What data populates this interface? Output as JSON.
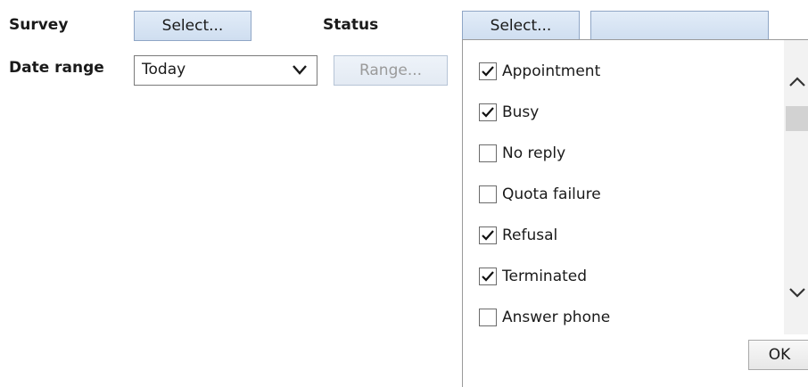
{
  "filters": {
    "survey_label": "Survey",
    "survey_button": "Select...",
    "status_label": "Status",
    "status_button": "Select...",
    "date_range_label": "Date range",
    "date_range_value": "Today",
    "range_button": "Range..."
  },
  "status_dropdown": {
    "options": [
      {
        "label": "Appointment",
        "checked": true
      },
      {
        "label": "Busy",
        "checked": true
      },
      {
        "label": "No reply",
        "checked": false
      },
      {
        "label": "Quota failure",
        "checked": false
      },
      {
        "label": "Refusal",
        "checked": true
      },
      {
        "label": "Terminated",
        "checked": true
      },
      {
        "label": "Answer phone",
        "checked": false
      }
    ],
    "ok_label": "OK"
  },
  "icons": {
    "dropdown_arrow": "chevron-down-icon",
    "scroll_up": "chevron-up-icon",
    "scroll_down": "chevron-down-icon",
    "check": "check-icon"
  },
  "colors": {
    "button_border": "#8fa6c6",
    "button_fill": "#d8e5f4",
    "disabled_text": "#9a9a9a"
  }
}
